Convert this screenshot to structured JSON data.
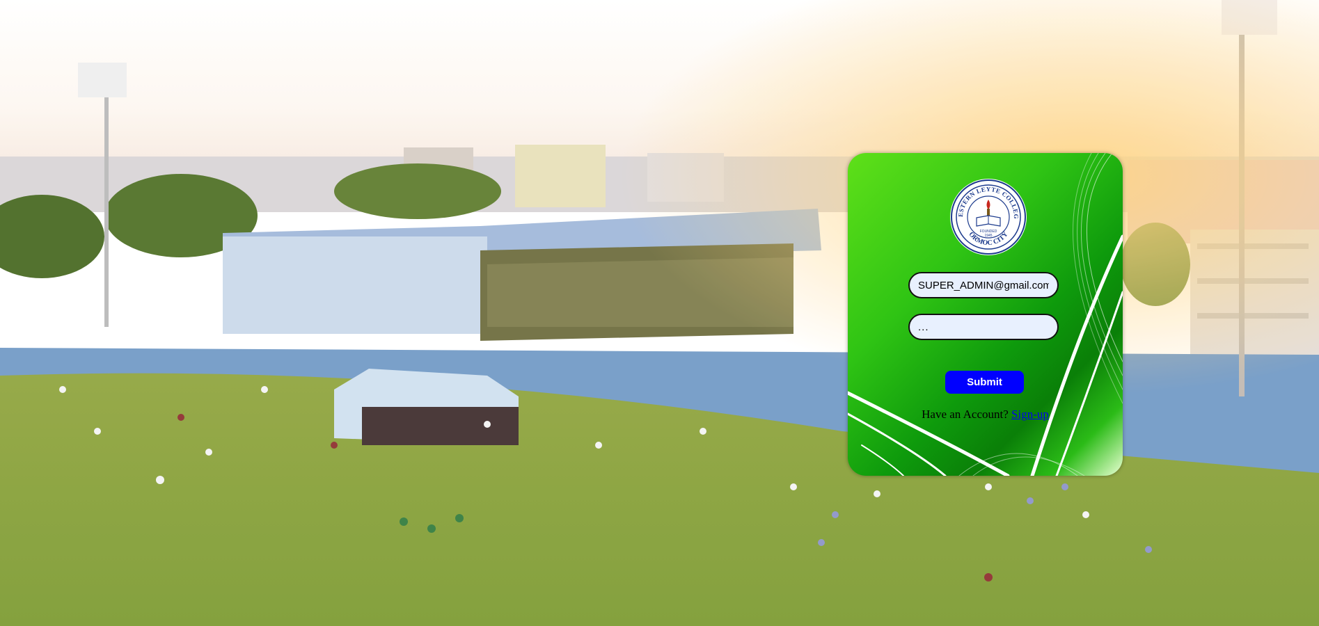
{
  "login": {
    "email_value": "SUPER_ADMIN@gmail.com",
    "password_value": "...",
    "submit_label": "Submit",
    "account_prompt": "Have an Account?",
    "signup_link": "Sign-up"
  },
  "seal": {
    "text_top": "WESTERN LEYTE COLLEGE",
    "text_bottom": "ORMOC CITY",
    "founded": "FOUNDED",
    "year": "1945"
  },
  "colors": {
    "submit_bg": "#0000ff",
    "card_green": "#2fc414",
    "link": "#0000ee",
    "seal_blue": "#1b3a8c"
  },
  "icons": {
    "seal": "college-seal-icon"
  }
}
